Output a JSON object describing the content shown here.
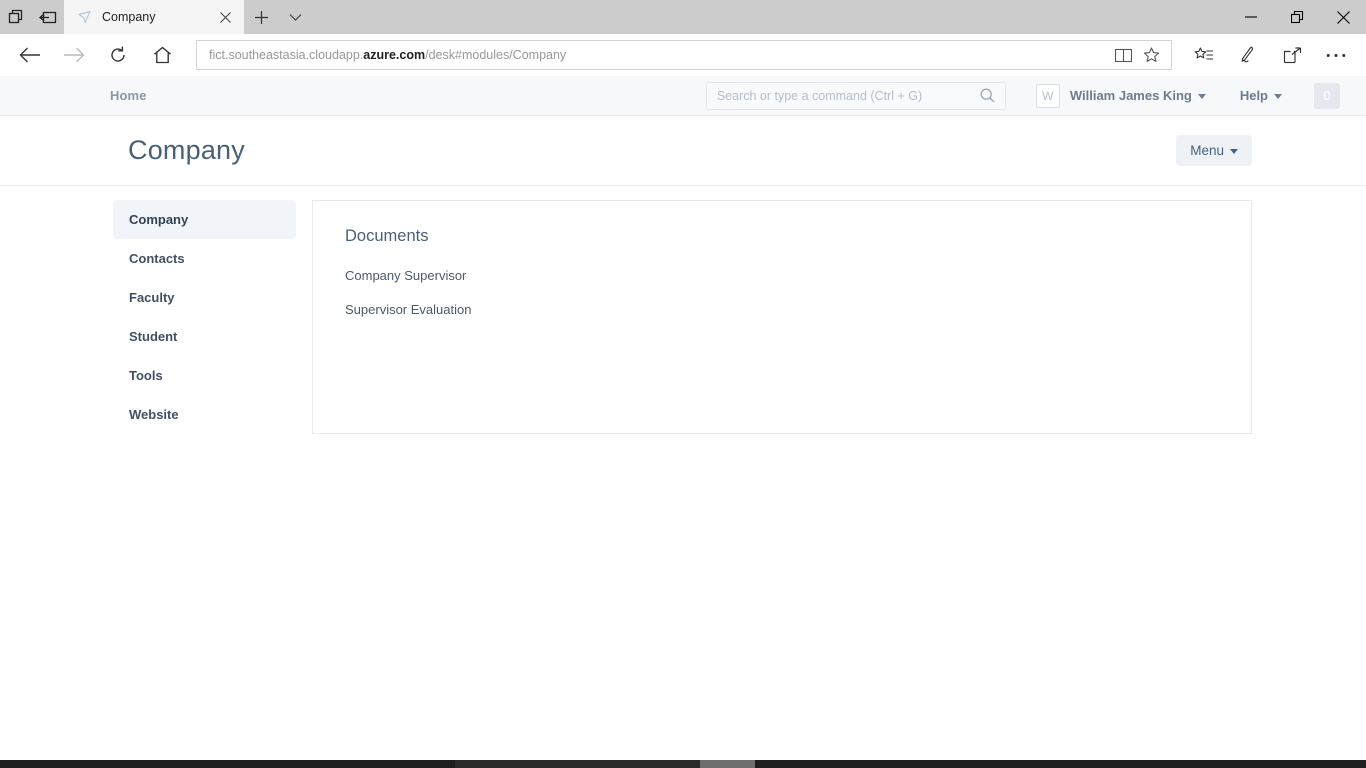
{
  "browser": {
    "tab": {
      "title": "Company",
      "favicon": "edge-page-icon"
    },
    "url": {
      "prefix": "fict.southeastasia.cloudapp.",
      "domain": "azure.com",
      "path": "/desk#modules/Company"
    },
    "buttons": {
      "tab_preview": "tab-preview-icon",
      "set_tabs_aside": "set-tabs-aside-icon",
      "new_tab": "new-tab-icon",
      "tab_menu": "chevron-down-icon",
      "back": "back-arrow-icon",
      "forward": "forward-arrow-icon",
      "refresh": "refresh-icon",
      "home": "home-icon",
      "reading_view": "reading-view-icon",
      "favorite": "star-icon",
      "favorites_hub": "favorites-list-icon",
      "web_notes": "pen-icon",
      "share": "share-icon",
      "settings": "ellipsis-icon",
      "minimize": "minimize-icon",
      "restore": "restore-icon",
      "close": "close-icon"
    }
  },
  "appnav": {
    "home_label": "Home",
    "search": {
      "placeholder": "Search or type a command (Ctrl + G)",
      "value": ""
    },
    "user": {
      "avatar_initial": "W",
      "name": "William James King"
    },
    "help_label": "Help",
    "badge_count": "0"
  },
  "page": {
    "title": "Company",
    "menu_label": "Menu"
  },
  "sidebar": {
    "items": [
      {
        "label": "Company",
        "active": true
      },
      {
        "label": "Contacts",
        "active": false
      },
      {
        "label": "Faculty",
        "active": false
      },
      {
        "label": "Student",
        "active": false
      },
      {
        "label": "Tools",
        "active": false
      },
      {
        "label": "Website",
        "active": false
      }
    ]
  },
  "panel": {
    "title": "Documents",
    "links": [
      {
        "label": "Company Supervisor"
      },
      {
        "label": "Supervisor Evaluation"
      }
    ]
  },
  "colors": {
    "accent": "#4a6076",
    "nav_bg": "#f6f8fa",
    "active_item_bg": "#f1f5f9",
    "badge_bg": "#e3e9ef"
  }
}
